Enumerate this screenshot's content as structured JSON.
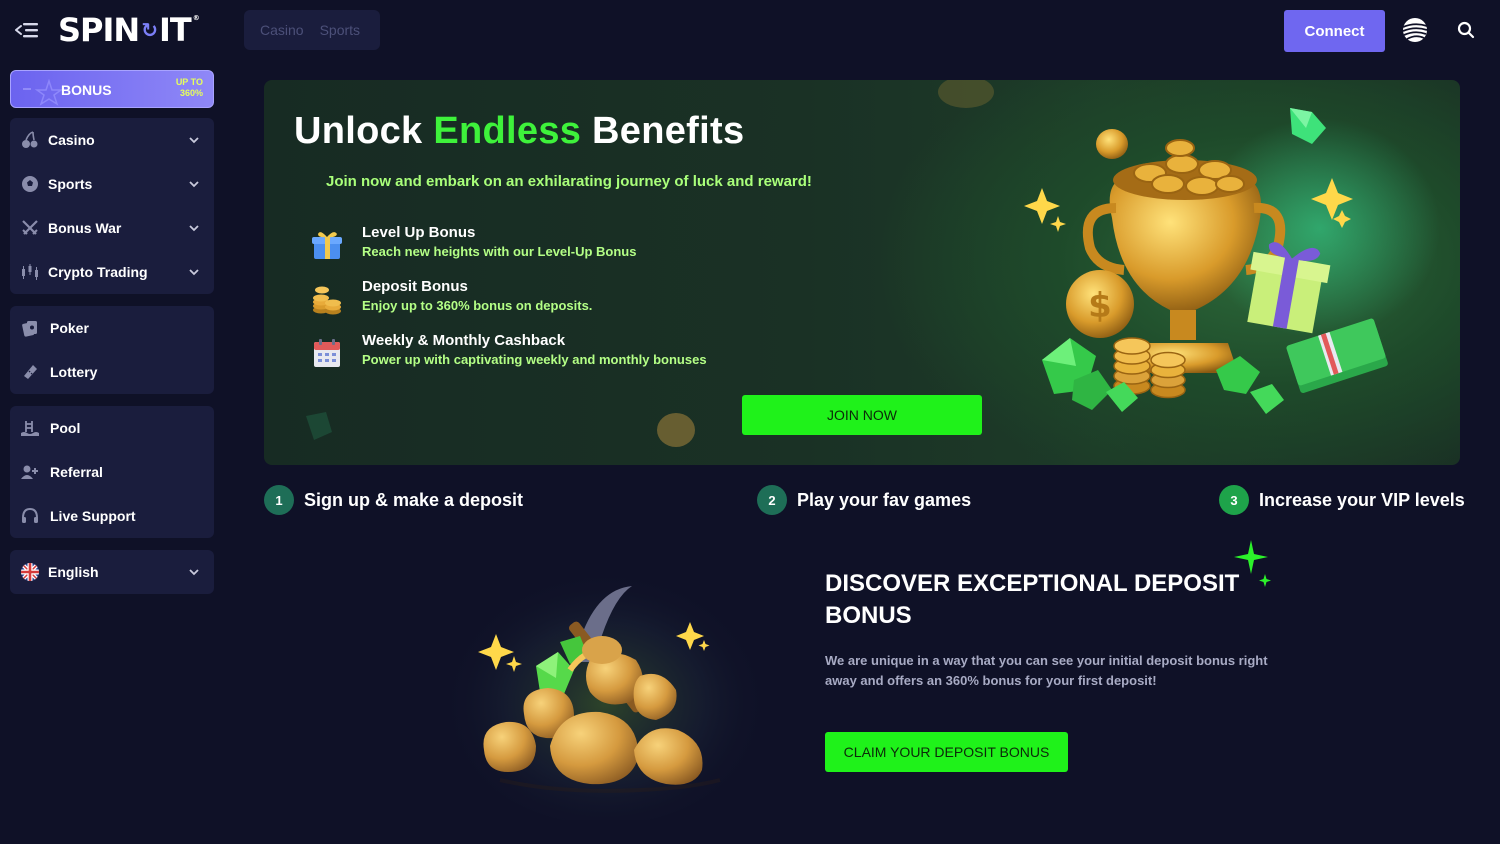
{
  "header": {
    "logo_text": "SPIN",
    "logo_text2": "IT",
    "logo_tm": "®",
    "segmented": [
      "Casino",
      "Sports"
    ],
    "connect_label": "Connect"
  },
  "sidebar": {
    "bonus": {
      "label": "BONUS",
      "upto_line1": "UP TO",
      "upto_line2": "360%"
    },
    "group1": [
      {
        "label": "Casino",
        "icon": "cherries-icon"
      },
      {
        "label": "Sports",
        "icon": "soccer-ball-icon"
      },
      {
        "label": "Bonus War",
        "icon": "crossed-swords-icon"
      },
      {
        "label": "Crypto Trading",
        "icon": "candlestick-chart-icon"
      }
    ],
    "group2": [
      {
        "label": "Poker",
        "icon": "poker-cards-icon"
      },
      {
        "label": "Lottery",
        "icon": "ticket-icon"
      }
    ],
    "group3": [
      {
        "label": "Pool",
        "icon": "pool-icon"
      },
      {
        "label": "Referral",
        "icon": "add-user-icon"
      },
      {
        "label": "Live Support",
        "icon": "headset-icon"
      }
    ],
    "language": {
      "label": "English",
      "icon": "uk-flag-icon"
    }
  },
  "hero": {
    "title_part1": "Unlock ",
    "title_highlight": "Endless",
    "title_part2": " Benefits",
    "subtitle": "Join now and embark on an exhilarating journey of luck and reward!",
    "benefits": [
      {
        "title": "Level Up Bonus",
        "desc": "Reach new heights with our Level-Up Bonus",
        "icon": "gift-box-icon"
      },
      {
        "title": "Deposit Bonus",
        "desc": "Enjoy up to 360% bonus on deposits.",
        "icon": "coin-stack-icon"
      },
      {
        "title": "Weekly & Monthly Cashback",
        "desc": "Power up with captivating weekly and monthly bonuses",
        "icon": "calendar-icon"
      }
    ],
    "join_label": "JOIN NOW"
  },
  "steps": [
    {
      "num": "1",
      "label": "Sign up & make a deposit"
    },
    {
      "num": "2",
      "label": "Play your fav games"
    },
    {
      "num": "3",
      "label": "Increase your VIP levels"
    }
  ],
  "deposit": {
    "title": "DISCOVER EXCEPTIONAL DEPOSIT BONUS",
    "desc": "We are unique in a way that you can see your initial deposit bonus right away and offers an 360% bonus for your first deposit!",
    "claim_label": "CLAIM YOUR DEPOSIT BONUS"
  },
  "colors": {
    "background": "#0f1127",
    "panel": "#1a1d3d",
    "accent_purple": "#6f67f0",
    "accent_green": "#1ff21a",
    "highlight_green": "#3ef23b"
  }
}
